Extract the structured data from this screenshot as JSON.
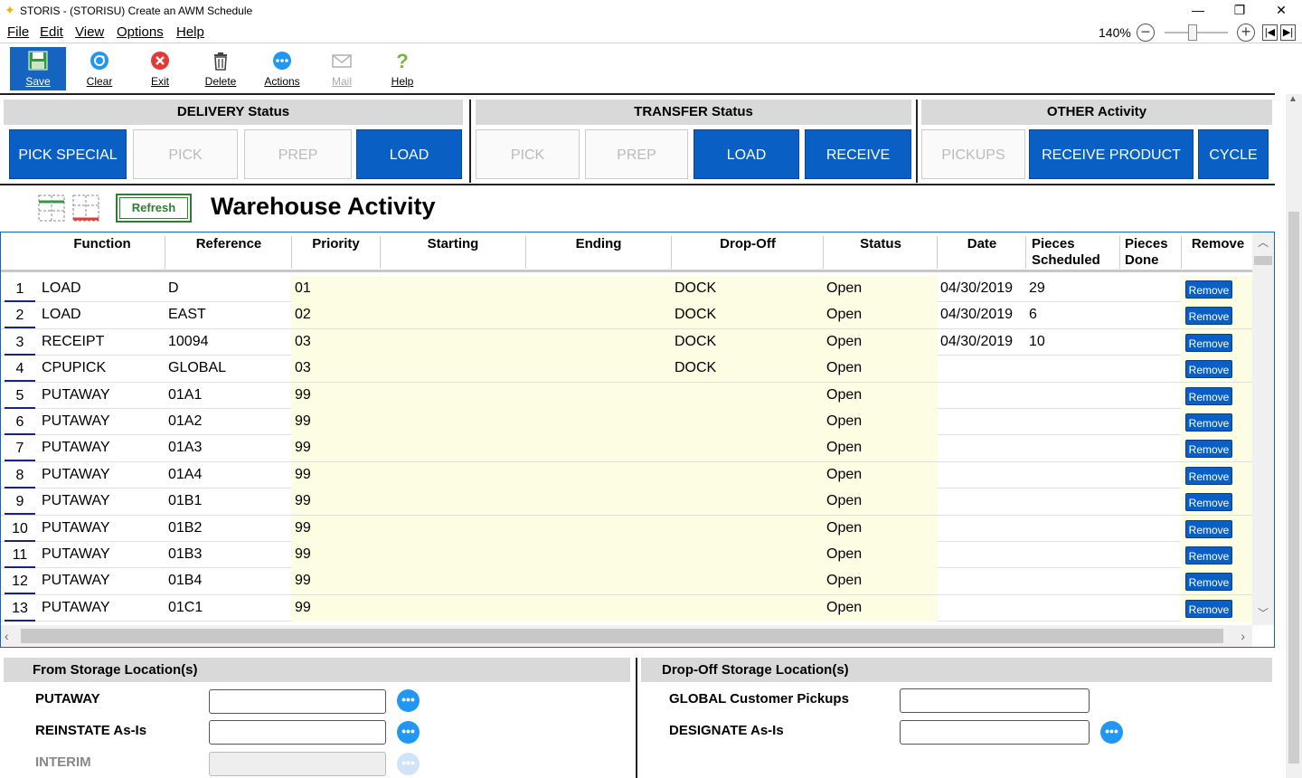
{
  "window": {
    "title": "STORIS - (STORISU) Create an AWM Schedule",
    "minimize": "—",
    "maximize": "❐",
    "close": "✕"
  },
  "menu": {
    "items": [
      {
        "label": "File"
      },
      {
        "label": "Edit"
      },
      {
        "label": "View"
      },
      {
        "label": "Options"
      },
      {
        "label": "Help"
      }
    ],
    "zoom": "140%",
    "zoom_out": "−",
    "zoom_in": "+"
  },
  "toolbar": {
    "save": "Save",
    "clear": "Clear",
    "exit": "Exit",
    "delete": "Delete",
    "actions": "Actions",
    "mail": "Mail",
    "help": "Help"
  },
  "delivery": {
    "title": "DELIVERY Status",
    "buttons": [
      {
        "label": "PICK SPECIAL",
        "active": true
      },
      {
        "label": "PICK",
        "active": false
      },
      {
        "label": "PREP",
        "active": false
      },
      {
        "label": "LOAD",
        "active": true
      }
    ]
  },
  "transfer": {
    "title": "TRANSFER Status",
    "buttons": [
      {
        "label": "PICK",
        "active": false
      },
      {
        "label": "PREP",
        "active": false
      },
      {
        "label": "LOAD",
        "active": true
      },
      {
        "label": "RECEIVE",
        "active": true
      }
    ]
  },
  "other": {
    "title": "OTHER Activity",
    "buttons": [
      {
        "label": "PICKUPS",
        "active": false
      },
      {
        "label": "RECEIVE PRODUCT",
        "active": true
      },
      {
        "label": "CYCLE",
        "active": true
      }
    ]
  },
  "warehouse": {
    "title": "Warehouse Activity",
    "refresh": "Refresh",
    "columns": {
      "function": "Function",
      "reference": "Reference",
      "priority": "Priority",
      "starting": "Starting",
      "ending": "Ending",
      "dropoff": "Drop-Off",
      "status": "Status",
      "date": "Date",
      "pieces_scheduled_1": "Pieces",
      "pieces_scheduled_2": "Scheduled",
      "pieces_done_1": "Pieces",
      "pieces_done_2": "Done",
      "remove": "Remove"
    },
    "remove_label": "Remove",
    "rows": [
      {
        "n": "1",
        "function": "LOAD",
        "reference": "D",
        "priority": "01",
        "starting": "",
        "ending": "",
        "dropoff": "DOCK",
        "status": "Open",
        "date": "04/30/2019",
        "scheduled": "29",
        "done": ""
      },
      {
        "n": "2",
        "function": "LOAD",
        "reference": "EAST",
        "priority": "02",
        "starting": "",
        "ending": "",
        "dropoff": "DOCK",
        "status": "Open",
        "date": "04/30/2019",
        "scheduled": "6",
        "done": ""
      },
      {
        "n": "3",
        "function": "RECEIPT",
        "reference": "10094",
        "priority": "03",
        "starting": "",
        "ending": "",
        "dropoff": "DOCK",
        "status": "Open",
        "date": "04/30/2019",
        "scheduled": "10",
        "done": ""
      },
      {
        "n": "4",
        "function": "CPUPICK",
        "reference": "GLOBAL",
        "priority": "03",
        "starting": "",
        "ending": "",
        "dropoff": "DOCK",
        "status": "Open",
        "date": "",
        "scheduled": "",
        "done": ""
      },
      {
        "n": "5",
        "function": "PUTAWAY",
        "reference": "01A1",
        "priority": "99",
        "starting": "",
        "ending": "",
        "dropoff": "",
        "status": "Open",
        "date": "",
        "scheduled": "",
        "done": ""
      },
      {
        "n": "6",
        "function": "PUTAWAY",
        "reference": "01A2",
        "priority": "99",
        "starting": "",
        "ending": "",
        "dropoff": "",
        "status": "Open",
        "date": "",
        "scheduled": "",
        "done": ""
      },
      {
        "n": "7",
        "function": "PUTAWAY",
        "reference": "01A3",
        "priority": "99",
        "starting": "",
        "ending": "",
        "dropoff": "",
        "status": "Open",
        "date": "",
        "scheduled": "",
        "done": ""
      },
      {
        "n": "8",
        "function": "PUTAWAY",
        "reference": "01A4",
        "priority": "99",
        "starting": "",
        "ending": "",
        "dropoff": "",
        "status": "Open",
        "date": "",
        "scheduled": "",
        "done": ""
      },
      {
        "n": "9",
        "function": "PUTAWAY",
        "reference": "01B1",
        "priority": "99",
        "starting": "",
        "ending": "",
        "dropoff": "",
        "status": "Open",
        "date": "",
        "scheduled": "",
        "done": ""
      },
      {
        "n": "10",
        "function": "PUTAWAY",
        "reference": "01B2",
        "priority": "99",
        "starting": "",
        "ending": "",
        "dropoff": "",
        "status": "Open",
        "date": "",
        "scheduled": "",
        "done": ""
      },
      {
        "n": "11",
        "function": "PUTAWAY",
        "reference": "01B3",
        "priority": "99",
        "starting": "",
        "ending": "",
        "dropoff": "",
        "status": "Open",
        "date": "",
        "scheduled": "",
        "done": ""
      },
      {
        "n": "12",
        "function": "PUTAWAY",
        "reference": "01B4",
        "priority": "99",
        "starting": "",
        "ending": "",
        "dropoff": "",
        "status": "Open",
        "date": "",
        "scheduled": "",
        "done": ""
      },
      {
        "n": "13",
        "function": "PUTAWAY",
        "reference": "01C1",
        "priority": "99",
        "starting": "",
        "ending": "",
        "dropoff": "",
        "status": "Open",
        "date": "",
        "scheduled": "",
        "done": ""
      }
    ]
  },
  "from_storage": {
    "title": "From Storage Location(s)",
    "fields": [
      {
        "label": "PUTAWAY",
        "value": "",
        "enabled": true
      },
      {
        "label": "REINSTATE As-Is",
        "value": "",
        "enabled": true
      },
      {
        "label": "INTERIM",
        "value": "",
        "enabled": false
      }
    ]
  },
  "dropoff_storage": {
    "title": "Drop-Off Storage Location(s)",
    "fields": [
      {
        "label": "GLOBAL Customer Pickups",
        "value": "",
        "has_button": false
      },
      {
        "label": "DESIGNATE As-Is",
        "value": "",
        "has_button": true
      }
    ]
  },
  "colors": {
    "accent": "#0a5fc4",
    "yellow_cell": "#fdfde3",
    "refresh_green": "#2e7d32",
    "exit_red": "#e53935",
    "help_green": "#7cb342"
  },
  "icons": {
    "save": "floppy-disk-icon",
    "clear": "refresh-circle-icon",
    "exit": "close-circle-icon",
    "delete": "trash-icon",
    "actions": "ellipsis-circle-icon",
    "mail": "mail-icon",
    "help": "question-mark-icon"
  }
}
